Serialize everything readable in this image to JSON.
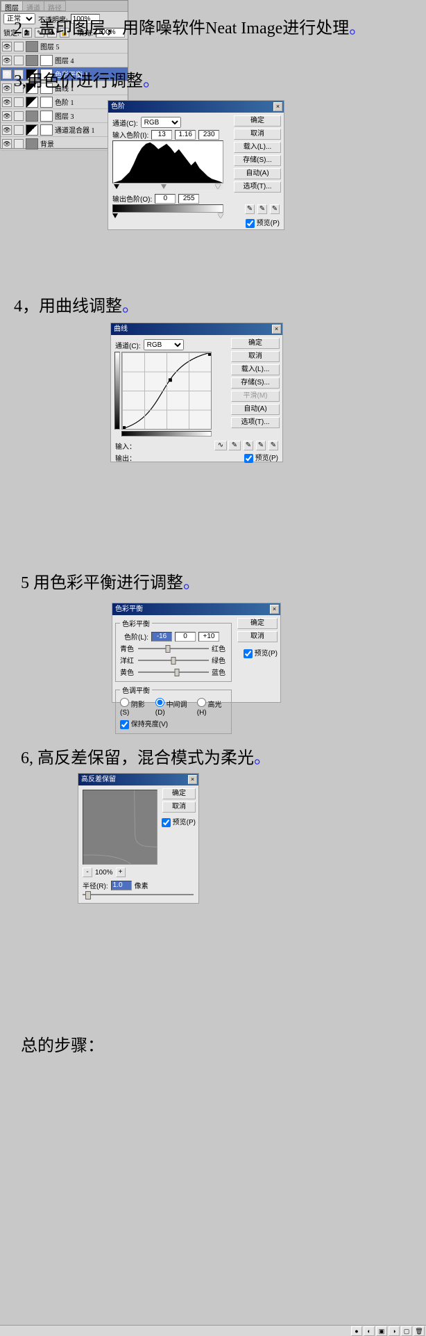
{
  "steps": {
    "s2": {
      "text": "2，盖印图层，用降噪软件Neat Image进行处理",
      "period": "。"
    },
    "s3": {
      "text": "3,用色价进行调整",
      "period": "。"
    },
    "s4": {
      "text": "4，用曲线调整",
      "period": "。"
    },
    "s5": {
      "text": "5  用色彩平衡进行调整",
      "period": "。"
    },
    "s6": {
      "text": "6, 高反差保留，混合模式为柔光",
      "period": "。"
    },
    "summary": "总的步骤："
  },
  "levels": {
    "title": "色阶",
    "channel_label": "通道(C):",
    "channel_value": "RGB",
    "input_label": "输入色阶(I):",
    "input_values": [
      "13",
      "1.16",
      "230"
    ],
    "output_label": "输出色阶(O):",
    "output_values": [
      "0",
      "255"
    ],
    "buttons": {
      "ok": "确定",
      "cancel": "取消",
      "load": "载入(L)...",
      "save": "存储(S)...",
      "auto": "自动(A)",
      "options": "选项(T)..."
    },
    "preview_label": "预览(P)"
  },
  "curves": {
    "title": "曲线",
    "channel_label": "通道(C):",
    "channel_value": "RGB",
    "input_label": "输入：",
    "output_label": "输出：",
    "buttons": {
      "ok": "确定",
      "cancel": "取消",
      "load": "载入(L)...",
      "save": "存储(S)...",
      "smooth": "平滑(M)",
      "auto": "自动(A)",
      "options": "选项(T)..."
    },
    "preview_label": "预览(P)"
  },
  "color_balance": {
    "title": "色彩平衡",
    "group1": "色彩平衡",
    "levels_label": "色阶(L):",
    "values": [
      "-16",
      "0",
      "+10"
    ],
    "sliders": [
      {
        "left": "青色",
        "right": "红色",
        "pos": 42
      },
      {
        "left": "洋红",
        "right": "绿色",
        "pos": 50
      },
      {
        "left": "黄色",
        "right": "蓝色",
        "pos": 55
      }
    ],
    "group2": "色调平衡",
    "radios": {
      "shadows": "阴影(S)",
      "midtones": "中间调(D)",
      "highlights": "高光(H)"
    },
    "preserve": "保持亮度(V)",
    "buttons": {
      "ok": "确定",
      "cancel": "取消"
    },
    "preview_label": "预览(P)"
  },
  "highpass": {
    "title": "高反差保留",
    "zoom_minus": "-",
    "zoom_value": "100%",
    "zoom_plus": "+",
    "radius_label": "半径(R):",
    "radius_value": "1.0",
    "radius_unit": "像素",
    "buttons": {
      "ok": "确定",
      "cancel": "取消"
    },
    "preview_label": "预览(P)"
  },
  "layers": {
    "tabs": {
      "layers": "图层",
      "channels": "通道",
      "paths": "路径"
    },
    "blend_value": "正常",
    "opacity_label": "不透明度:",
    "opacity_value": "100%",
    "lock_label": "锁定:",
    "fill_label": "填充:",
    "fill_value": "100%",
    "items": [
      {
        "name": "图层 5",
        "sel": false,
        "adj": false,
        "mask": false
      },
      {
        "name": "图层 4",
        "sel": false,
        "adj": false,
        "mask": true
      },
      {
        "name": "色彩平衡 1",
        "sel": true,
        "adj": true,
        "mask": true
      },
      {
        "name": "曲线 1",
        "sel": false,
        "adj": true,
        "mask": true
      },
      {
        "name": "色阶 1",
        "sel": false,
        "adj": true,
        "mask": true
      },
      {
        "name": "图层 3",
        "sel": false,
        "adj": false,
        "mask": true
      },
      {
        "name": "通道混合器 1",
        "sel": false,
        "adj": true,
        "mask": true
      },
      {
        "name": "背景",
        "sel": false,
        "adj": false,
        "mask": false
      }
    ]
  }
}
